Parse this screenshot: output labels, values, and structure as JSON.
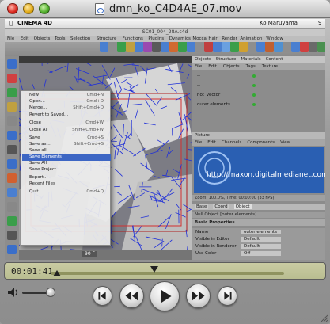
{
  "window": {
    "title": "dmn_ko_C4D4AE_07.mov"
  },
  "macmenu": {
    "app": "CINEMA 4D",
    "user": "Ko Maruyama",
    "clock": "9"
  },
  "c4d": {
    "doc_title": "SC01_004_28A.c4d",
    "menu": [
      "File",
      "Edit",
      "Objects",
      "Tools",
      "Selection",
      "Structure",
      "Functions",
      "Plugins",
      "Dynamics",
      "Mocca",
      "Hair",
      "Render",
      "Animation",
      "Window"
    ],
    "file_menu": [
      {
        "label": "New",
        "shortcut": "Cmd+N"
      },
      {
        "label": "Open...",
        "shortcut": "Cmd+O"
      },
      {
        "label": "Merge...",
        "shortcut": "Shift+Cmd+O"
      },
      {
        "label": "Revert to Saved...",
        "shortcut": ""
      },
      {
        "label": "Close",
        "shortcut": "Cmd+W"
      },
      {
        "label": "Close All",
        "shortcut": "Shift+Cmd+W"
      },
      {
        "label": "Save",
        "shortcut": "Cmd+S"
      },
      {
        "label": "Save as...",
        "shortcut": "Shift+Cmd+S"
      },
      {
        "label": "Save all",
        "shortcut": ""
      },
      {
        "label": "Save Elements",
        "shortcut": ""
      },
      {
        "label": "Save All",
        "shortcut": ""
      },
      {
        "label": "Save Project...",
        "shortcut": ""
      },
      {
        "label": "Export...",
        "shortcut": ""
      },
      {
        "label": "Recent Files",
        "shortcut": ""
      },
      {
        "label": "Quit",
        "shortcut": "Cmd+Q"
      }
    ],
    "selected_item": "Save Elements",
    "objects_tabs": [
      "Objects",
      "Structure",
      "Materials",
      "Content"
    ],
    "objects_menu": [
      "File",
      "Edit",
      "Objects",
      "Tags",
      "Texture"
    ],
    "object_rows": [
      "--",
      "--",
      "hot_vector",
      "outer elements"
    ],
    "picture": {
      "header": "Picture",
      "menu": [
        "File",
        "Edit",
        "Channels",
        "Components",
        "View"
      ],
      "url": "http://maxon.digitalmedianet.com",
      "status": "Zoom: 100.0%, Time: 00:00:00 (33 FPS)"
    },
    "attributes": {
      "tabs": [
        "Base",
        "Coord",
        "Object"
      ],
      "title": "Null Object [outer elements]",
      "section": "Basic Properties",
      "rows": [
        {
          "k": "Name",
          "v": "outer elements"
        },
        {
          "k": "Visible in Editor",
          "v": "Default"
        },
        {
          "k": "Visible in Renderer",
          "v": "Default"
        },
        {
          "k": "Use Color",
          "v": "Off"
        }
      ]
    },
    "frame_counter": "90 F"
  },
  "player": {
    "timecode": "00:01:41"
  },
  "colors": {
    "selection": "#3d66c4",
    "picture_bg": "#2a5fb2",
    "lcd": "#c1c499"
  }
}
